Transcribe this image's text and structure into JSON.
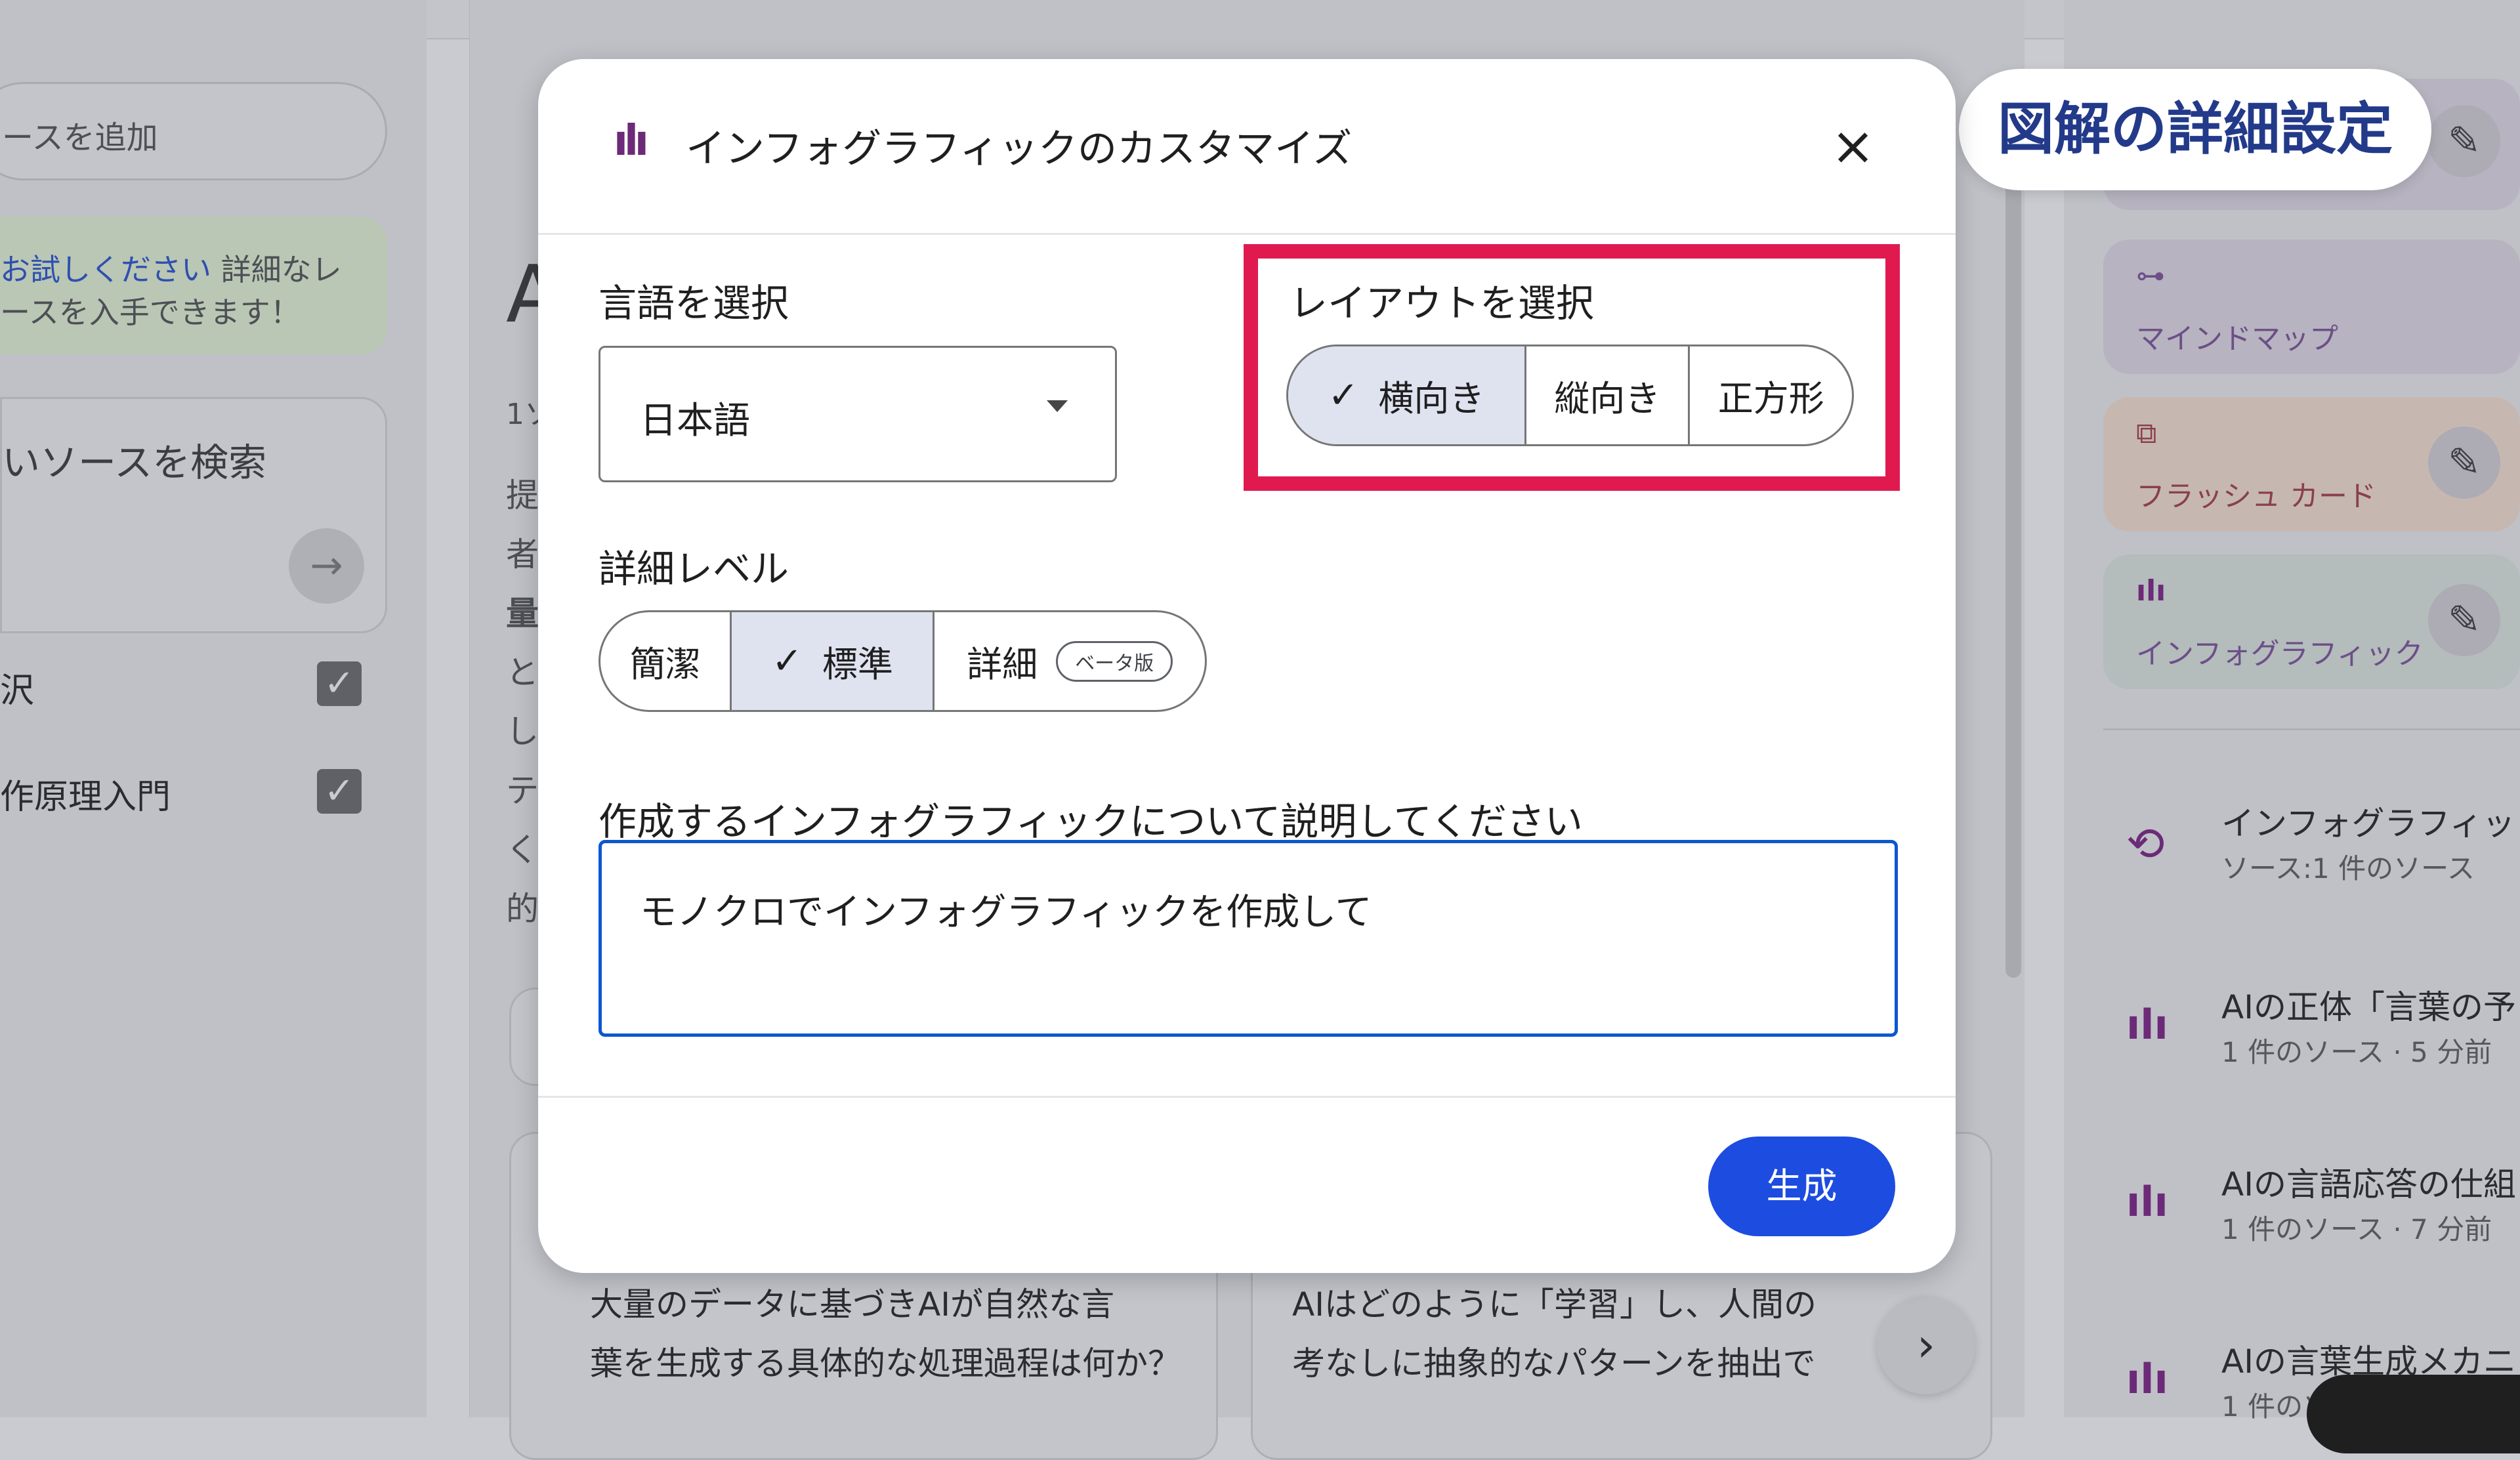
{
  "callout": {
    "text": "図解の詳細設定"
  },
  "background": {
    "left": {
      "add_source": "ースを追加",
      "tip_link": "お試しください",
      "tip_line1_rest": " 詳細なレ",
      "tip_line2": "ースを入手できます！",
      "search_title": "いソースを検索",
      "arrow": "→",
      "sources": [
        {
          "label": "沢",
          "checked": true
        },
        {
          "label": "作原理入門",
          "checked": true
        }
      ]
    },
    "center": {
      "title_char": "A",
      "meta": "1ソ",
      "body_chars": [
        "提",
        "者",
        "量",
        "と",
        "し",
        "テ",
        "く",
        "的"
      ],
      "suggestions": [
        {
          "line1": "大量のデータに基づきAIが自然な言",
          "line2": "葉を生成する具体的な処理過程は何か？"
        },
        {
          "line1": "AIはどのように「学習」し、人間の",
          "line2": "考なしに抽象的なパターンを抽出で"
        }
      ],
      "next": "›"
    },
    "right": {
      "cards": [
        {
          "label": "マインドマップ",
          "icon": "mindmap-icon"
        },
        {
          "label": "フラッシュ カード",
          "icon": "flashcard-icon",
          "edit": "✎"
        },
        {
          "label": "インフォグラフィック",
          "icon": "infographic-icon",
          "edit": "✎"
        }
      ],
      "top_edit": "✎",
      "list": [
        {
          "title": "インフォグラフィッ",
          "sub": "ソース:1 件のソース",
          "icon": "sync-icon"
        },
        {
          "title": "AIの正体「言葉の予",
          "sub": "1 件のソース · 5 分前",
          "icon": "infographic-icon"
        },
        {
          "title": "AIの言語応答の仕組",
          "sub": "1 件のソース · 7 分前",
          "icon": "infographic-icon"
        },
        {
          "title": "AIの言葉生成メカニ",
          "sub": "1 件のソ",
          "icon": "infographic-icon"
        }
      ]
    }
  },
  "modal": {
    "title": "インフォグラフィックのカスタマイズ",
    "close": "×",
    "language": {
      "label": "言語を選択",
      "value": "日本語"
    },
    "layout": {
      "label": "レイアウトを選択",
      "options": [
        "横向き",
        "縦向き",
        "正方形"
      ],
      "selected": "横向き"
    },
    "detail": {
      "label": "詳細レベル",
      "options": [
        "簡潔",
        "標準",
        "詳細"
      ],
      "selected": "標準",
      "beta_badge": "ベータ版"
    },
    "prompt": {
      "label": "作成するインフォグラフィックについて説明してください",
      "value": "モノクロでインフォグラフィックを作成して"
    },
    "generate_label": "生成"
  },
  "colors": {
    "accent_blue": "#1d4ce0",
    "highlight_red": "#e01a4f",
    "callout_text": "#233a8a",
    "infographic_purple": "#6c2a78"
  }
}
